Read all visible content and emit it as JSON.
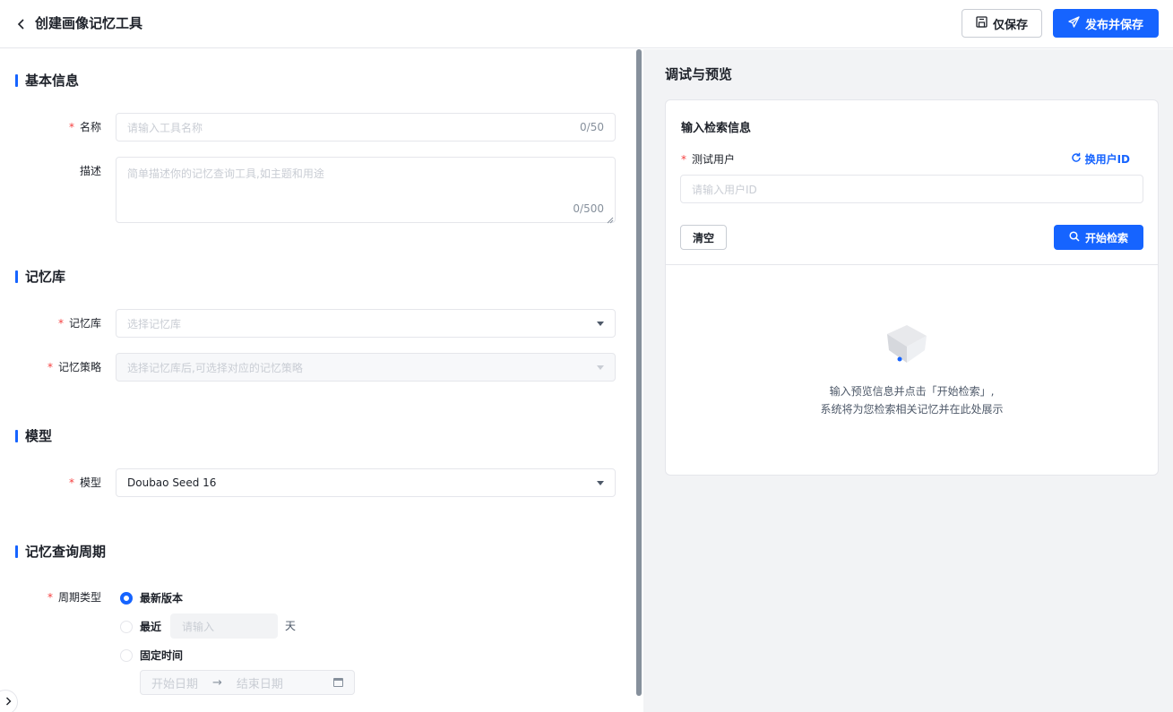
{
  "header": {
    "back_icon": "chevron-left-icon",
    "title": "创建画像记忆工具",
    "save_only_label": "仅保存",
    "publish_save_label": "发布并保存"
  },
  "basic_info": {
    "section_title": "基本信息",
    "name_label": "名称",
    "name_placeholder": "请输入工具名称",
    "name_count": "0/50",
    "desc_label": "描述",
    "desc_placeholder": "简单描述你的记忆查询工具,如主题和用途",
    "desc_count": "0/500"
  },
  "memory_store": {
    "section_title": "记忆库",
    "store_label": "记忆库",
    "store_placeholder": "选择记忆库",
    "strategy_label": "记忆策略",
    "strategy_placeholder": "选择记忆库后,可选择对应的记忆策略"
  },
  "model": {
    "section_title": "模型",
    "model_label": "模型",
    "model_value": "Doubao Seed 16"
  },
  "query_period": {
    "section_title": "记忆查询周期",
    "type_label": "周期类型",
    "option_latest": "最新版本",
    "option_recent": "最近",
    "recent_placeholder": "请输入",
    "recent_unit": "天",
    "option_fixed": "固定时间",
    "start_date_placeholder": "开始日期",
    "range_arrow": "→",
    "end_date_placeholder": "结束日期",
    "selected": "最新版本"
  },
  "preview": {
    "title": "调试与预览",
    "card_title": "输入检索信息",
    "test_user_label": "测试用户",
    "switch_user_label": "换用户ID",
    "user_id_placeholder": "请输入用户ID",
    "clear_label": "清空",
    "search_label": "开始检索",
    "empty_line1": "输入预览信息并点击「开始检索」,",
    "empty_line2": "系统将为您检索相关记忆并在此处展示"
  },
  "required_mark": "*",
  "colors": {
    "primary": "#1664ff",
    "required": "#f53f3f",
    "panel_bg": "#f2f3f5"
  }
}
